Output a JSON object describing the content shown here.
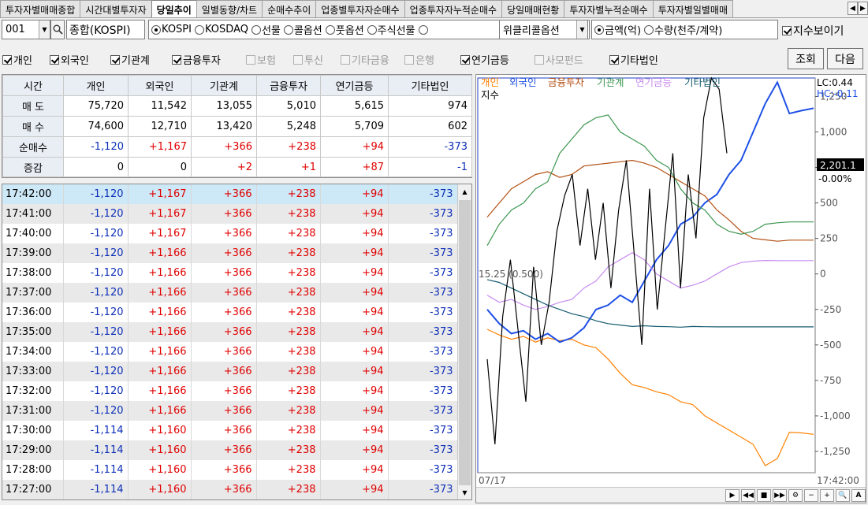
{
  "tabs": [
    {
      "label": "투자자별매매종합",
      "active": false
    },
    {
      "label": "시간대별투자자",
      "active": false
    },
    {
      "label": "당일추이",
      "active": true
    },
    {
      "label": "일별동향/차트",
      "active": false
    },
    {
      "label": "순매수추이",
      "active": false
    },
    {
      "label": "업종별투자자순매수",
      "active": false
    },
    {
      "label": "업종투자자누적순매수",
      "active": false
    },
    {
      "label": "당일매매현황",
      "active": false
    },
    {
      "label": "투자자별누적순매수",
      "active": false
    },
    {
      "label": "투자자별일별매매",
      "active": false
    }
  ],
  "toolbar": {
    "code_value": "001",
    "market_value": "종합(KOSPI)",
    "market_radios": [
      {
        "label": "KOSPI",
        "checked": true
      },
      {
        "label": "KOSDAQ",
        "checked": false
      },
      {
        "label": "선물",
        "checked": false
      },
      {
        "label": "콜옵션",
        "checked": false
      },
      {
        "label": "풋옵션",
        "checked": false
      },
      {
        "label": "주식선물",
        "checked": false
      },
      {
        "label": "",
        "checked": false
      }
    ],
    "option_combo": "위클리콜옵션",
    "unit_radios": [
      {
        "label": "금액(억)",
        "checked": true
      },
      {
        "label": "수량(천주/계약)",
        "checked": false
      }
    ],
    "show_index_label": "지수보이기",
    "show_index_checked": true,
    "investor_checks": [
      {
        "label": "개인",
        "checked": true,
        "enabled": true
      },
      {
        "label": "외국인",
        "checked": true,
        "enabled": true
      },
      {
        "label": "기관계",
        "checked": true,
        "enabled": true
      },
      {
        "label": "금융투자",
        "checked": true,
        "enabled": true
      },
      {
        "label": "보험",
        "checked": false,
        "enabled": false
      },
      {
        "label": "투신",
        "checked": false,
        "enabled": false
      },
      {
        "label": "기타금융",
        "checked": false,
        "enabled": false
      },
      {
        "label": "은행",
        "checked": false,
        "enabled": false
      },
      {
        "label": "연기금등",
        "checked": true,
        "enabled": true
      },
      {
        "label": "사모펀드",
        "checked": false,
        "enabled": false
      },
      {
        "label": "기타법인",
        "checked": true,
        "enabled": true
      }
    ],
    "query_label": "조회",
    "next_label": "다음"
  },
  "summary": {
    "headers": [
      "시간",
      "개인",
      "외국인",
      "기관계",
      "금융투자",
      "연기금등",
      "기타법인"
    ],
    "rows": [
      {
        "label": "매 도",
        "values": [
          "75,720",
          "11,542",
          "13,055",
          "5,010",
          "5,615",
          "974"
        ]
      },
      {
        "label": "매 수",
        "values": [
          "74,600",
          "12,710",
          "13,420",
          "5,248",
          "5,709",
          "602"
        ]
      },
      {
        "label": "순매수",
        "values": [
          "-1,120",
          "+1,167",
          "+366",
          "+238",
          "+94",
          "-373"
        ]
      },
      {
        "label": "증감",
        "values": [
          "0",
          "0",
          "+2",
          "+1",
          "+87",
          "-1"
        ]
      }
    ]
  },
  "timeseries": [
    {
      "time": "17:42:00",
      "values": [
        "-1,120",
        "+1,167",
        "+366",
        "+238",
        "+94",
        "-373"
      ]
    },
    {
      "time": "17:41:00",
      "values": [
        "-1,120",
        "+1,167",
        "+366",
        "+238",
        "+94",
        "-373"
      ]
    },
    {
      "time": "17:40:00",
      "values": [
        "-1,120",
        "+1,167",
        "+366",
        "+238",
        "+94",
        "-373"
      ]
    },
    {
      "time": "17:39:00",
      "values": [
        "-1,120",
        "+1,166",
        "+366",
        "+238",
        "+94",
        "-373"
      ]
    },
    {
      "time": "17:38:00",
      "values": [
        "-1,120",
        "+1,166",
        "+366",
        "+238",
        "+94",
        "-373"
      ]
    },
    {
      "time": "17:37:00",
      "values": [
        "-1,120",
        "+1,166",
        "+366",
        "+238",
        "+94",
        "-373"
      ]
    },
    {
      "time": "17:36:00",
      "values": [
        "-1,120",
        "+1,166",
        "+366",
        "+238",
        "+94",
        "-373"
      ]
    },
    {
      "time": "17:35:00",
      "values": [
        "-1,120",
        "+1,166",
        "+366",
        "+238",
        "+94",
        "-373"
      ]
    },
    {
      "time": "17:34:00",
      "values": [
        "-1,120",
        "+1,166",
        "+366",
        "+238",
        "+94",
        "-373"
      ]
    },
    {
      "time": "17:33:00",
      "values": [
        "-1,120",
        "+1,166",
        "+366",
        "+238",
        "+94",
        "-373"
      ]
    },
    {
      "time": "17:32:00",
      "values": [
        "-1,120",
        "+1,166",
        "+366",
        "+238",
        "+94",
        "-373"
      ]
    },
    {
      "time": "17:31:00",
      "values": [
        "-1,120",
        "+1,166",
        "+366",
        "+238",
        "+94",
        "-373"
      ]
    },
    {
      "time": "17:30:00",
      "values": [
        "-1,114",
        "+1,160",
        "+366",
        "+238",
        "+94",
        "-373"
      ]
    },
    {
      "time": "17:29:00",
      "values": [
        "-1,114",
        "+1,160",
        "+366",
        "+238",
        "+94",
        "-373"
      ]
    },
    {
      "time": "17:28:00",
      "values": [
        "-1,114",
        "+1,160",
        "+366",
        "+238",
        "+94",
        "-373"
      ]
    },
    {
      "time": "17:27:00",
      "values": [
        "-1,114",
        "+1,160",
        "+366",
        "+238",
        "+94",
        "-373"
      ]
    }
  ],
  "chart_data": {
    "type": "line",
    "legend": [
      {
        "name": "개인",
        "color": "#ff8000"
      },
      {
        "name": "외국인",
        "color": "#1e50e6"
      },
      {
        "name": "금융투자",
        "color": "#b45014"
      },
      {
        "name": "기관계",
        "color": "#3c9650"
      },
      {
        "name": "연기금등",
        "color": "#c88cf0"
      },
      {
        "name": "기타법인",
        "color": "#145a6e"
      },
      {
        "name": "지수",
        "color": "#000000"
      }
    ],
    "lc_text": "LC:0.44",
    "hc_text": "HC:-0.11",
    "y_ticks": [
      1250,
      1000,
      750,
      500,
      250,
      0,
      -250,
      -500,
      -750,
      -1000,
      -1250
    ],
    "y_tick_labels": [
      "1,250",
      "1,000",
      "750",
      "500",
      "250",
      "0",
      "-250",
      "-500",
      "-750",
      "-1,000",
      "-1,250"
    ],
    "ylim": [
      -1400,
      1380
    ],
    "x_start_label": "07/17",
    "x_end_label": "17:42:00",
    "index_value_label": "2,201.1",
    "index_change_label": "-0.00%",
    "annotation": "15.25 (0.500)",
    "series": [
      {
        "name": "개인",
        "color": "#ff8000",
        "values": [
          -390,
          -430,
          -460,
          -440,
          -480,
          -450,
          -470,
          -460,
          -500,
          -520,
          -600,
          -700,
          -780,
          -800,
          -830,
          -850,
          -900,
          -920,
          -1000,
          -1050,
          -1100,
          -1150,
          -1200,
          -1350,
          -1300,
          -1115,
          -1120,
          -1130
        ]
      },
      {
        "name": "외국인",
        "color": "#1e50e6",
        "values": [
          -250,
          -350,
          -420,
          -400,
          -460,
          -420,
          -480,
          -450,
          -380,
          -250,
          -220,
          -150,
          -200,
          -50,
          100,
          200,
          350,
          400,
          500,
          560,
          700,
          800,
          1000,
          1200,
          1350,
          1130,
          1150,
          1167
        ]
      },
      {
        "name": "금융투자",
        "color": "#b45014",
        "values": [
          400,
          500,
          600,
          650,
          700,
          720,
          680,
          700,
          760,
          770,
          780,
          790,
          800,
          780,
          750,
          700,
          650,
          600,
          550,
          450,
          380,
          300,
          250,
          240,
          230,
          238,
          238,
          238
        ]
      },
      {
        "name": "기관계",
        "color": "#3c9650",
        "values": [
          200,
          350,
          450,
          500,
          600,
          650,
          850,
          950,
          1050,
          1100,
          1120,
          1000,
          950,
          900,
          800,
          750,
          600,
          500,
          450,
          350,
          300,
          280,
          300,
          350,
          360,
          366,
          366,
          366
        ]
      },
      {
        "name": "연기금등",
        "color": "#c88cf0",
        "values": [
          -150,
          -200,
          -180,
          -220,
          -250,
          -230,
          -200,
          -180,
          -100,
          -50,
          50,
          100,
          150,
          100,
          0,
          -50,
          -100,
          -80,
          -50,
          0,
          50,
          80,
          90,
          95,
          94,
          94,
          94,
          94
        ]
      },
      {
        "name": "기타법인",
        "color": "#145a6e",
        "values": [
          -40,
          -60,
          -100,
          -140,
          -180,
          -220,
          -250,
          -280,
          -300,
          -330,
          -350,
          -360,
          -370,
          -365,
          -370,
          -372,
          -375,
          -370,
          -372,
          -373,
          -373,
          -373,
          -373,
          -373,
          -373,
          -373,
          -373,
          -373
        ]
      },
      {
        "name": "지수",
        "color": "#000000",
        "values": [
          -600,
          -1200,
          -300,
          100,
          -400,
          -900,
          50,
          -500,
          -200,
          300,
          550,
          700,
          200,
          600,
          100,
          500,
          -100,
          450,
          800,
          150,
          -500,
          600,
          -250,
          300,
          850,
          -100,
          700,
          250,
          1100,
          1380,
          1300,
          850
        ]
      }
    ]
  }
}
